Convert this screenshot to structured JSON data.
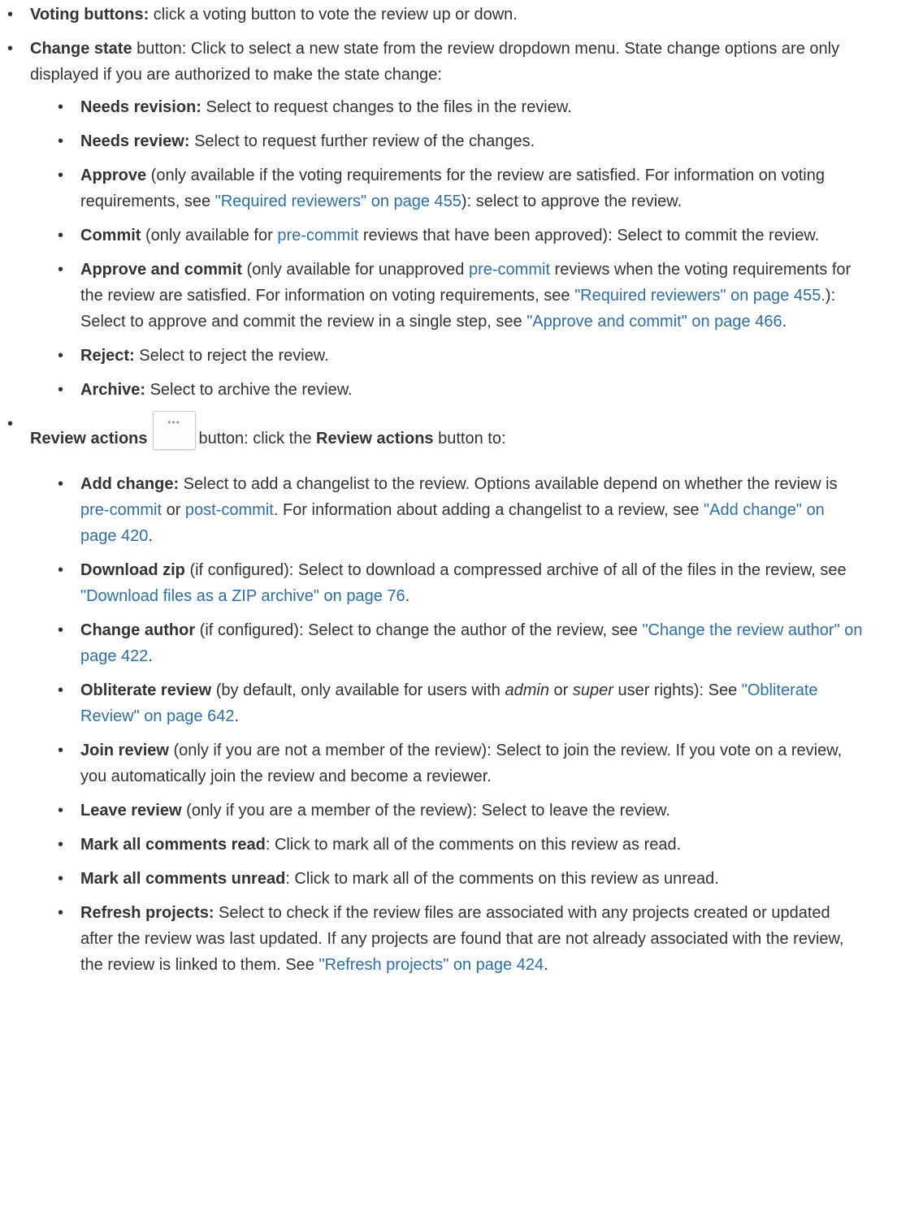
{
  "items": {
    "voting": {
      "label": "Voting buttons:",
      "text": " click a voting button to vote the review up or down."
    },
    "change_state": {
      "label": "Change state",
      "text": " button: Click to select a new state from the review dropdown menu. State change options are only displayed if you are authorized to make the state change:",
      "sub": {
        "needs_revision": {
          "label": "Needs revision:",
          "text": " Select to request changes to the files in the review."
        },
        "needs_review": {
          "label": "Needs review:",
          "text": " Select to request further review of the changes."
        },
        "approve": {
          "label": "Approve",
          "text1": " (only available if the voting requirements for the review are satisfied. For information on voting requirements, see ",
          "link1": "\"Required reviewers\" on page 455",
          "text2": "): select to approve the review."
        },
        "commit": {
          "label": "Commit",
          "text1": " (only available for ",
          "link1": "pre-commit",
          "text2": " reviews that have been approved): Select to commit the review."
        },
        "approve_commit": {
          "label": "Approve and commit",
          "text1": " (only available for unapproved ",
          "link1": "pre-commit",
          "text2": " reviews when the voting requirements for the review are satisfied. For information on voting requirements, see ",
          "link2": "\"Required reviewers\" on page 455.",
          "text3": "): Select to approve and commit the review in a single step, see ",
          "link3": "\"Approve and commit\" on page 466",
          "text4": "."
        },
        "reject": {
          "label": "Reject:",
          "text": " Select to reject the review."
        },
        "archive": {
          "label": "Archive:",
          "text": " Select to archive the review."
        }
      }
    },
    "review_actions": {
      "label": "Review actions",
      "button_glyph": "•••",
      "text1": "button: click the ",
      "label2": "Review actions",
      "text2": " button to:",
      "sub": {
        "add_change": {
          "label": "Add change:",
          "text1": " Select to add a changelist to the review. Options available depend on whether the review is ",
          "link1": "pre-commit",
          "text2": " or ",
          "link2": "post-commit",
          "text3": ". For information about adding a changelist to a review, see ",
          "link3": "\"Add change\" on page 420",
          "text4": "."
        },
        "download_zip": {
          "label": "Download zip",
          "text1": " (if configured): Select to download a compressed archive of all of the files in the review, see ",
          "link1": "\"Download files as a ZIP archive\" on page 76",
          "text2": "."
        },
        "change_author": {
          "label": "Change author",
          "text1": " (if configured): Select to change the author of the review, see ",
          "link1": "\"Change the review author\" on page 422",
          "text2": "."
        },
        "obliterate": {
          "label": "Obliterate review",
          "text1": " (by default, only available for users with ",
          "em1": "admin",
          "text2": " or ",
          "em2": "super",
          "text3": " user rights): See ",
          "link1": "\"Obliterate Review\" on page 642",
          "text4": "."
        },
        "join": {
          "label": "Join review",
          "text": " (only if you are not a member of the review): Select to join the review. If you vote on a review, you automatically join the review and become a reviewer."
        },
        "leave": {
          "label": "Leave review",
          "text": " (only if you are a member of the review): Select to leave the review."
        },
        "mark_read": {
          "label": "Mark all comments read",
          "text": ": Click to mark all of the comments on this review as read."
        },
        "mark_unread": {
          "label": "Mark all comments unread",
          "text": ": Click to mark all of the comments on this review as unread."
        },
        "refresh": {
          "label": "Refresh projects:",
          "text1": " Select to check if the review files are associated with any projects created or updated after the review was last updated. If any projects are found that are not already associated with the review, the review is linked to them. See ",
          "link1": "\"Refresh projects\" on page 424",
          "text2": "."
        }
      }
    }
  },
  "colors": {
    "text": "#333333",
    "link": "#2f6ea8",
    "background": "#ffffff"
  }
}
